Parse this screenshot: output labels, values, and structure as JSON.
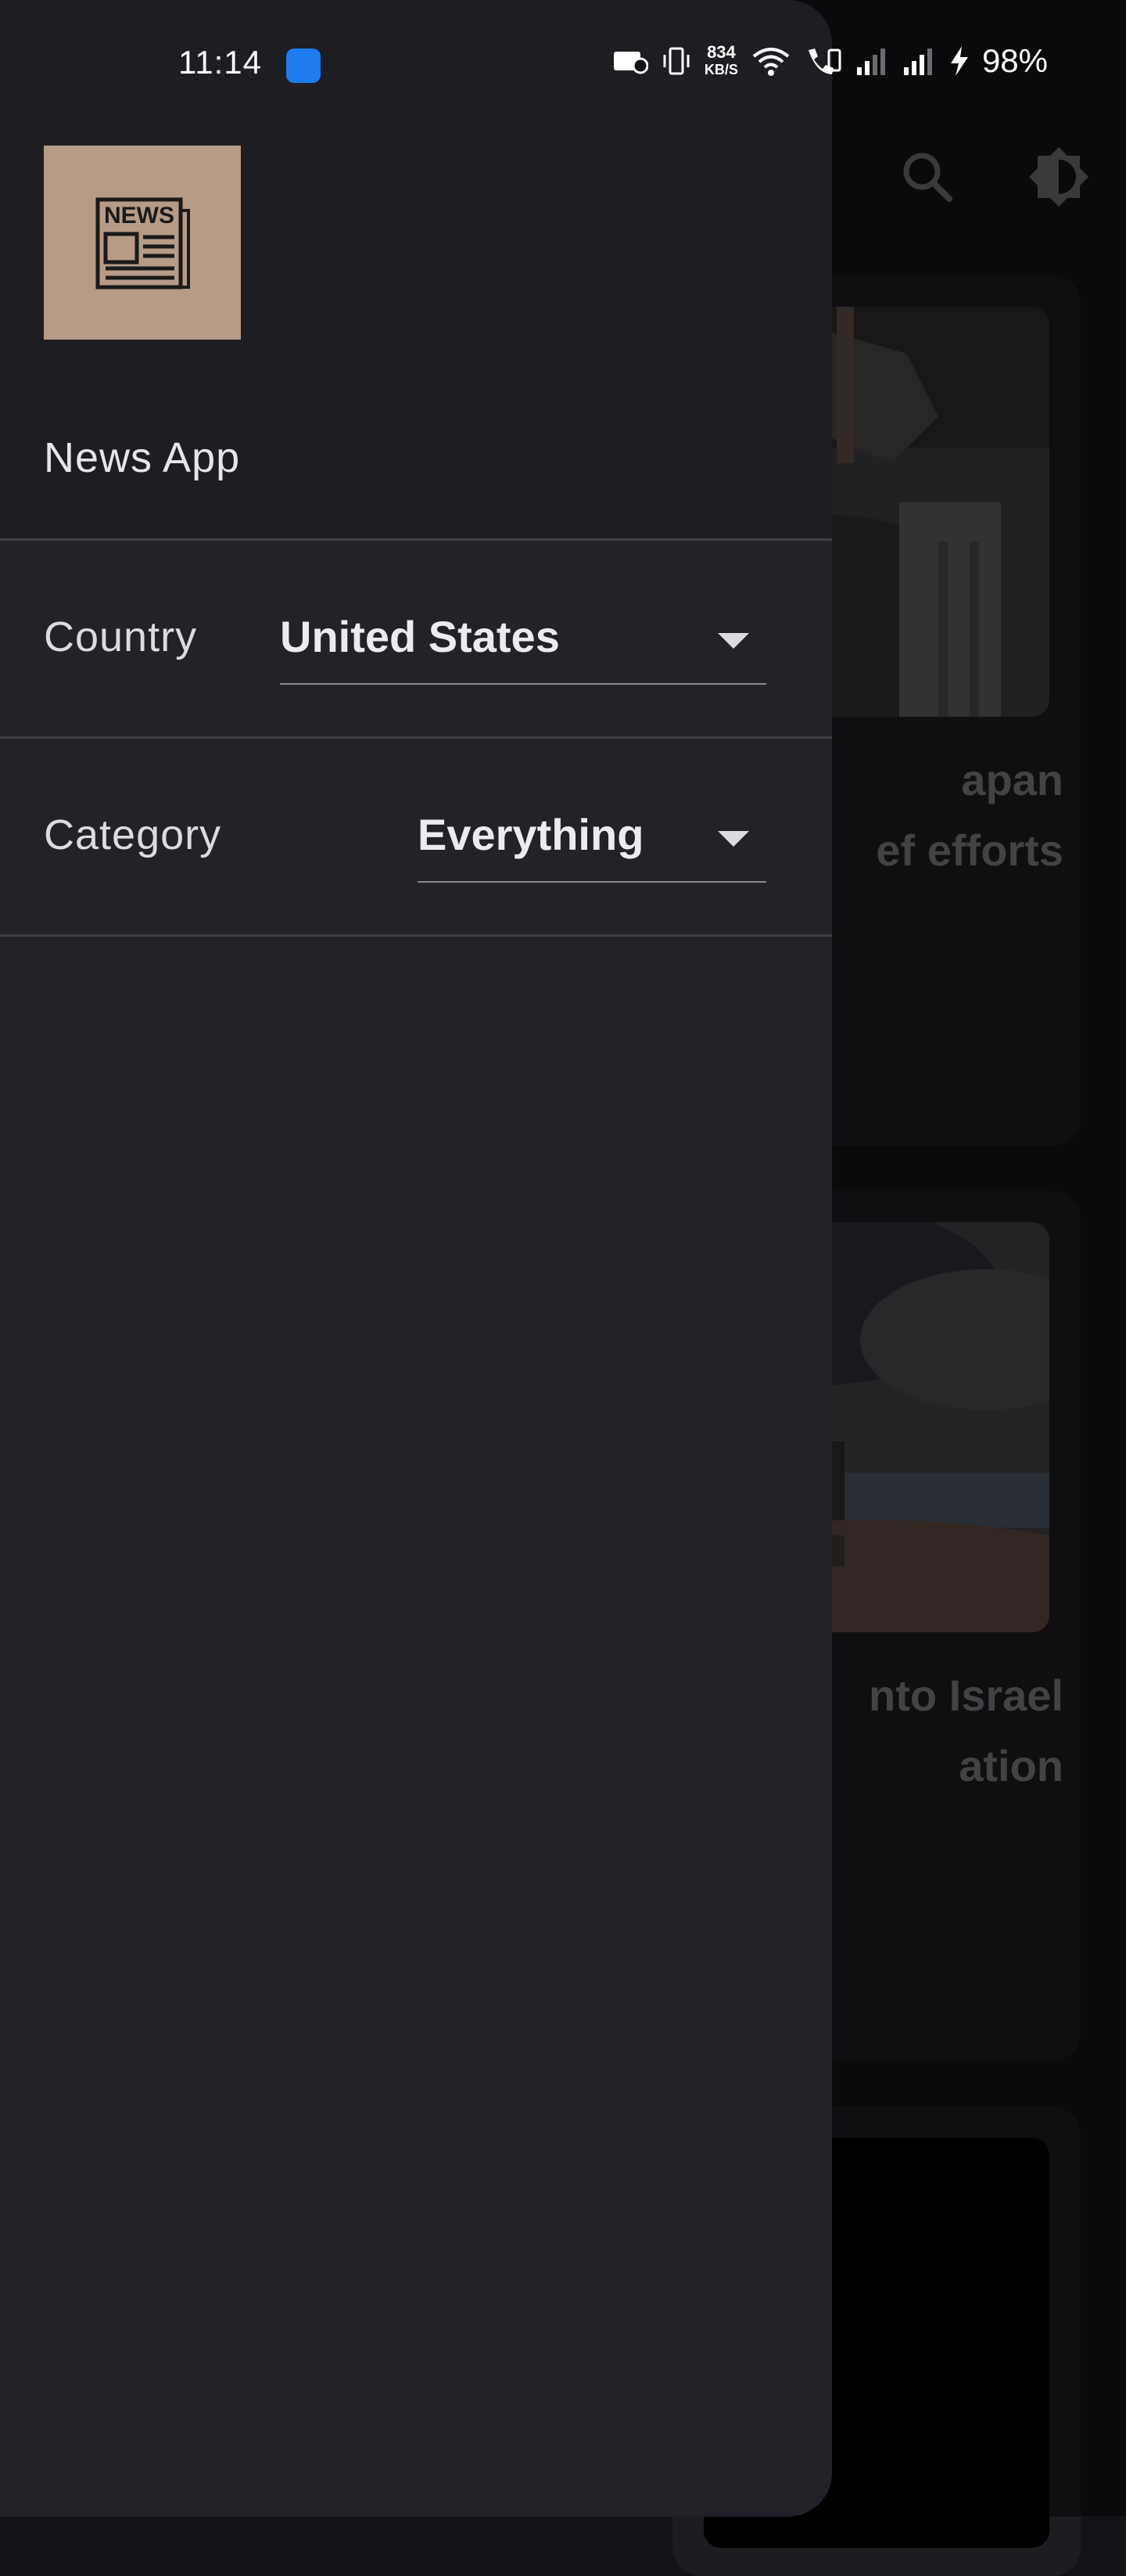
{
  "status_bar": {
    "time": "11:14",
    "net_speed_value": "834",
    "net_speed_unit": "KB/S",
    "battery": "98%"
  },
  "drawer": {
    "app_name": "News App",
    "logo_text": "NEWS",
    "country": {
      "label": "Country",
      "value": "United States"
    },
    "category": {
      "label": "Category",
      "value": "Everything"
    }
  },
  "background": {
    "cards": [
      {
        "title": "apan\nef efforts"
      },
      {
        "title": "nto Israel\nation"
      }
    ]
  },
  "colors": {
    "drawer_bg": "#222228",
    "header_bg": "#1d1d22",
    "logo_bg": "#b69b87",
    "status_badge": "#1e7cf2"
  }
}
